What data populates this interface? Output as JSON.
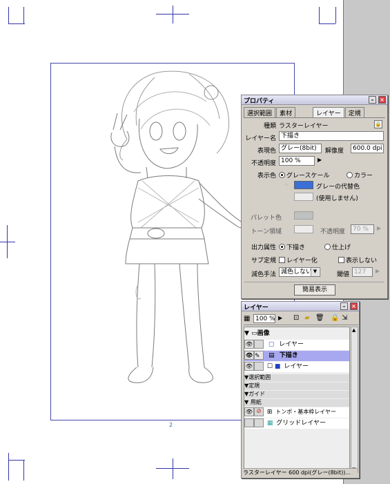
{
  "canvas": {
    "page_number": "2"
  },
  "properties_panel": {
    "title": "プロパティ",
    "tabs": [
      "選択範囲",
      "素材",
      "レイヤー",
      "定規"
    ],
    "active_tab": "レイヤー",
    "kind_label": "種類",
    "kind_value": "ラスターレイヤー",
    "layer_name_label": "レイヤー名",
    "layer_name_value": "下描き",
    "expression_label": "表現色",
    "expression_value": "グレー(8bit)",
    "resolution_label": "解像度",
    "resolution_value": "600.0 dpi",
    "opacity_label": "不透明度",
    "opacity_value": "100 %",
    "display_color_label": "表示色",
    "display_grayscale": "グレースケール",
    "display_color": "カラー",
    "gray_substitute": "グレーの代替色",
    "not_used": "(使用しません)",
    "palette_label": "パレット色",
    "tone_area_label": "トーン領域",
    "tone_opacity_label": "不透明度",
    "tone_opacity_value": "70 %",
    "output_label": "出力属性",
    "output_draft": "下描き",
    "output_finish": "仕上げ",
    "sub_ruler_label": "サブ定規",
    "layerize": "レイヤー化",
    "hide": "表示しない",
    "reduce_label": "減色手法",
    "reduce_value": "減色しない",
    "threshold_label": "閾値",
    "threshold_value": "127",
    "simple_view_button": "簡易表示",
    "accent_color": "#3a6fd8"
  },
  "layers_panel": {
    "title": "レイヤー",
    "opacity_value": "100 %",
    "folder_image": "画像",
    "layer_1": "レイヤー",
    "layer_2": "下描き",
    "layer_3": "レイヤー",
    "section_selection": "選択範囲",
    "section_ruler": "定規",
    "section_guide": "ガイド",
    "section_paper": "用紙",
    "layer_tombo": "トンボ・基本枠レイヤー",
    "layer_grid": "グリッドレイヤー",
    "status_bar": "ラスターレイヤー 600 dpi(グレー(8bit))..."
  }
}
